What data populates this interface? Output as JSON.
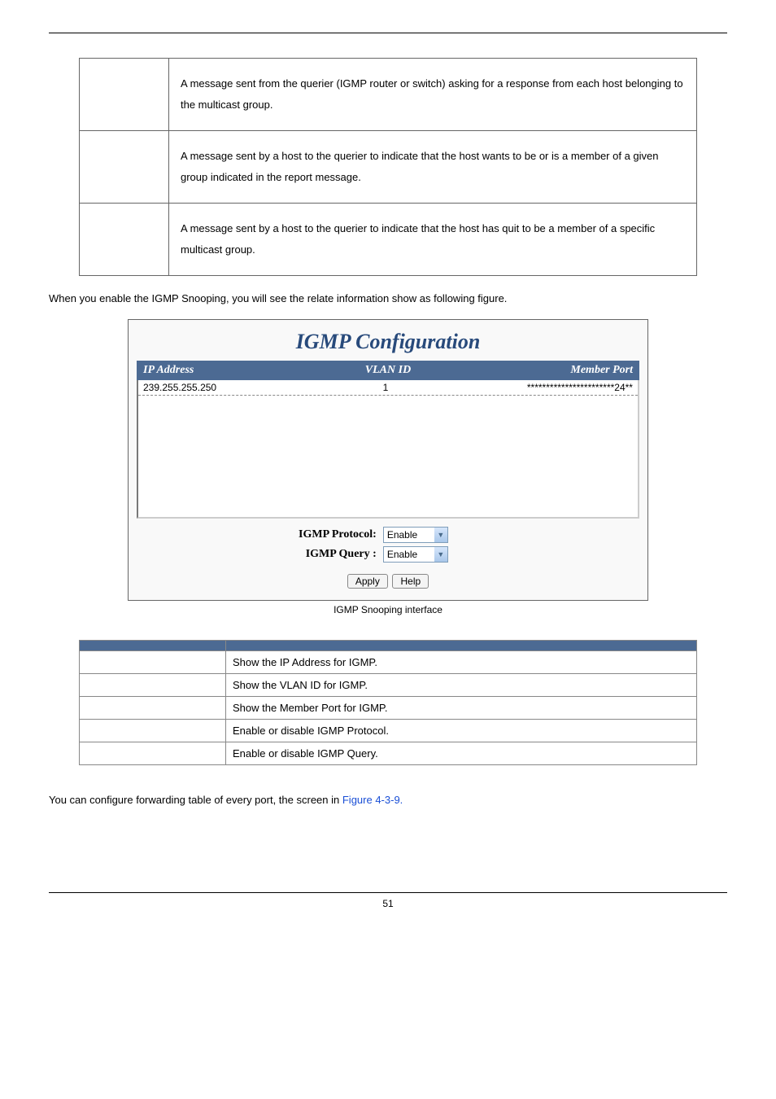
{
  "messages": {
    "rows": [
      {
        "label": "",
        "text": "A message sent from the querier (IGMP router or switch) asking for a response from each host belonging to the multicast group."
      },
      {
        "label": "",
        "text": "A message sent by a host to the querier to indicate that the host wants to be or is a member of a given group indicated in the report message."
      },
      {
        "label": "",
        "text": "A message sent by a host to the querier to indicate that the host has quit to be a member of a specific multicast group."
      }
    ]
  },
  "note": "When you enable the IGMP Snooping, you will see the relate information show as following figure.",
  "shot": {
    "title": "IGMP Configuration",
    "headers": {
      "ip": "IP Address",
      "vlan": "VLAN ID",
      "port": "Member Port"
    },
    "row": {
      "ip": "239.255.255.250",
      "vlan": "1",
      "port": "***********************24**"
    },
    "protocol_label": "IGMP Protocol:",
    "protocol_value": "Enable",
    "query_label": "IGMP Query    :",
    "query_value": "Enable",
    "btn_apply": "Apply",
    "btn_help": "Help",
    "caption": "IGMP Snooping interface"
  },
  "desc": {
    "headers": {
      "field": "",
      "desc": ""
    },
    "rows": [
      {
        "field": "",
        "desc": "Show the IP Address for IGMP."
      },
      {
        "field": "",
        "desc": "Show the VLAN ID for IGMP."
      },
      {
        "field": "",
        "desc": "Show the Member Port for IGMP."
      },
      {
        "field": "",
        "desc": "Enable or disable IGMP Protocol."
      },
      {
        "field": "",
        "desc": "Enable or disable IGMP Query."
      }
    ]
  },
  "section_head": "",
  "para_text": "You can configure forwarding table of every port, the screen in ",
  "para_link": "Figure 4-3-9.",
  "page_number": "51"
}
